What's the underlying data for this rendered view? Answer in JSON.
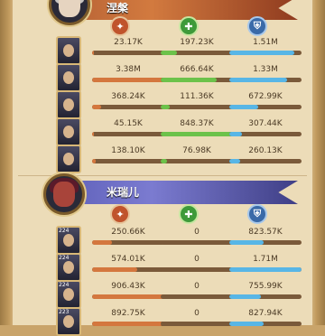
{
  "team1": {
    "name": "涅槃",
    "rows": [
      {
        "level": "",
        "damage": "23.17K",
        "damage_pct": 0.03,
        "heal": "197.23K",
        "heal_pct": 0.22,
        "tank": "1.51M",
        "tank_pct": 0.9
      },
      {
        "level": "",
        "damage": "3.38M",
        "damage_pct": 1.0,
        "heal": "666.64K",
        "heal_pct": 0.78,
        "tank": "1.33M",
        "tank_pct": 0.8
      },
      {
        "level": "",
        "damage": "368.24K",
        "damage_pct": 0.12,
        "heal": "111.36K",
        "heal_pct": 0.13,
        "tank": "672.99K",
        "tank_pct": 0.4
      },
      {
        "level": "",
        "damage": "45.15K",
        "damage_pct": 0.02,
        "heal": "848.37K",
        "heal_pct": 1.0,
        "tank": "307.44K",
        "tank_pct": 0.18
      },
      {
        "level": "",
        "damage": "138.10K",
        "damage_pct": 0.05,
        "heal": "76.98K",
        "heal_pct": 0.09,
        "tank": "260.13K",
        "tank_pct": 0.15
      }
    ]
  },
  "team2": {
    "name": "米瑞儿",
    "rows": [
      {
        "level": "224",
        "damage": "250.66K",
        "damage_pct": 0.28,
        "heal": "0",
        "heal_pct": 0.0,
        "tank": "823.57K",
        "tank_pct": 0.48
      },
      {
        "level": "224",
        "damage": "574.01K",
        "damage_pct": 0.63,
        "heal": "0",
        "heal_pct": 0.0,
        "tank": "1.71M",
        "tank_pct": 1.0
      },
      {
        "level": "224",
        "damage": "906.43K",
        "damage_pct": 1.0,
        "heal": "0",
        "heal_pct": 0.0,
        "tank": "755.99K",
        "tank_pct": 0.44
      },
      {
        "level": "223",
        "damage": "892.75K",
        "damage_pct": 0.98,
        "heal": "0",
        "heal_pct": 0.0,
        "tank": "827.94K",
        "tank_pct": 0.48
      }
    ]
  },
  "colors": {
    "damage": "#d4773e",
    "heal": "#6cc24a",
    "tank": "#58b6e6"
  }
}
